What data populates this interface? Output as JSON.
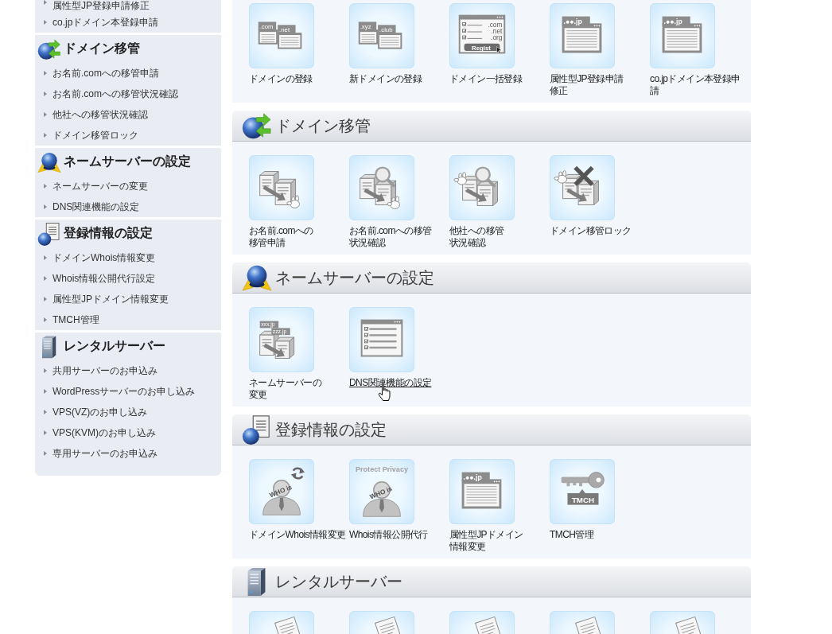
{
  "sidebar": {
    "groups": [
      {
        "items": [
          "属性型JP登録申請修正",
          "co.jpドメイン本登録申請"
        ]
      },
      {
        "title": "ドメイン移管",
        "kind": "transfer",
        "items": [
          "お名前.comへの移管申請",
          "お名前.comへの移管状況確認",
          "他社への移管状況確認",
          "ドメイン移管ロック"
        ]
      },
      {
        "title": "ネームサーバーの設定",
        "kind": "nameserver",
        "items": [
          "ネームサーバーの変更",
          "DNS関連機能の設定"
        ]
      },
      {
        "title": "登録情報の設定",
        "kind": "registration",
        "items": [
          "ドメインWhois情報変更",
          "Whois情報公開代行設定",
          "属性型JPドメイン情報変更",
          "TMCH管理"
        ]
      },
      {
        "title": "レンタルサーバー",
        "kind": "server",
        "items": [
          "共用サーバーのお申込み",
          "WordPressサーバーのお申し込み",
          "VPS(VZ)のお申し込み",
          "VPS(KVM)のお申し込み",
          "専用サーバーのお申込み"
        ]
      }
    ]
  },
  "main": {
    "sections": [
      {
        "tiles": [
          {
            "kind": "domains",
            "icon_text": [
              ".com",
              ".net"
            ],
            "label": "ドメインの登録",
            "hovered": false
          },
          {
            "kind": "domains",
            "icon_text": [
              ".xyz",
              ".club"
            ],
            "label": "新ドメインの登録",
            "hovered": false
          },
          {
            "kind": "bulk",
            "icon_text": [
              ".com",
              ".net",
              ".org",
              "Regist"
            ],
            "label": "ドメイン一括登録",
            "hovered": false
          },
          {
            "kind": "jp-window",
            "icon_text": [
              ".●●.jp"
            ],
            "label": "属性型JP登録申請修正",
            "hovered": false
          },
          {
            "kind": "jp-window",
            "icon_text": [
              ".●●.jp"
            ],
            "label": "co.jpドメイン本登録申請",
            "hovered": false
          }
        ]
      },
      {
        "title": "ドメイン移管",
        "kind": "transfer",
        "tiles": [
          {
            "kind": "transfer",
            "label": "お名前.comへの移管申請",
            "hovered": false
          },
          {
            "kind": "transfer-search",
            "label": "お名前.comへの移管状況確認",
            "hovered": false
          },
          {
            "kind": "transfer-search-other",
            "label": "他社への移管状況確認",
            "hovered": false
          },
          {
            "kind": "transfer-lock",
            "label": "ドメイン移管ロック",
            "hovered": false
          }
        ]
      },
      {
        "title": "ネームサーバーの設定",
        "kind": "nameserver",
        "tiles": [
          {
            "kind": "nameserver",
            "icon_text": [
              "xxx.jp",
              "zzz.jp"
            ],
            "label": "ネームサーバーの変更",
            "hovered": false
          },
          {
            "kind": "checklist",
            "label": "DNS関連機能の設定",
            "hovered": true
          }
        ]
      },
      {
        "title": "登録情報の設定",
        "kind": "registration",
        "tiles": [
          {
            "kind": "whois-refresh",
            "icon_text": [
              "WHO is"
            ],
            "label": "ドメインWhois情報変更",
            "hovered": false
          },
          {
            "kind": "whois-privacy",
            "icon_text": [
              "Protect Privacy",
              "WHO is"
            ],
            "label": "Whois情報公開代行",
            "hovered": false
          },
          {
            "kind": "jp-window",
            "icon_text": [
              ".●●.jp"
            ],
            "label": "属性型JPドメイン情報変更",
            "hovered": false
          },
          {
            "kind": "key",
            "icon_text": [
              "TMCH"
            ],
            "label": "TMCH管理",
            "hovered": false
          }
        ]
      },
      {
        "title": "レンタルサーバー",
        "kind": "server",
        "tiles": [
          {
            "kind": "server-doc"
          },
          {
            "kind": "server-doc"
          },
          {
            "kind": "server-doc"
          },
          {
            "kind": "server-doc"
          },
          {
            "kind": "server-doc"
          }
        ]
      }
    ]
  }
}
